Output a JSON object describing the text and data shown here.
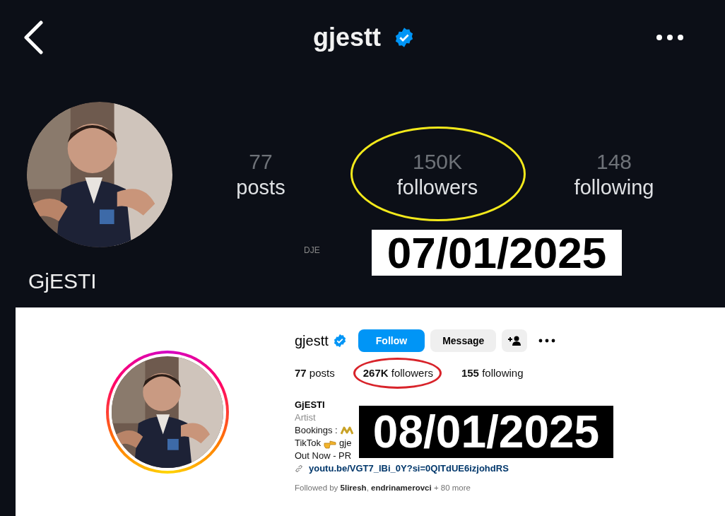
{
  "top_screen": {
    "title": "gjestt",
    "stats": [
      {
        "value": "77",
        "label": "posts",
        "circled": false
      },
      {
        "value": "150K",
        "label": "followers",
        "circled": true
      },
      {
        "value": "148",
        "label": "following",
        "circled": false
      }
    ],
    "stray_text": "DJE",
    "name": "GjESTI"
  },
  "top_stamp": "07/01/2025",
  "bottom_screen": {
    "username": "gjestt",
    "buttons": [
      "Follow",
      "Message"
    ],
    "stats": [
      {
        "text": "**77** posts",
        "circled": false
      },
      {
        "text": "**267K** followers",
        "circled": true
      },
      {
        "text": "**155** following",
        "circled": false
      }
    ],
    "name": "GjESTI",
    "category": "Artist",
    "bio_lines": [
      {
        "text": "Bookings :",
        "kind": "zigzag"
      },
      {
        "text": "TikTok",
        "kind": "hand",
        "after": "gje"
      },
      {
        "text": "Out Now - PR"
      }
    ],
    "link": "youtu.be/VGT7_lBi_0Y?si=0QITdUE6izjohdRS",
    "followed_by": "Followed by **5liresh**, **endrinamerovci** + 80 more"
  },
  "bottom_stamp": "08/01/2025"
}
